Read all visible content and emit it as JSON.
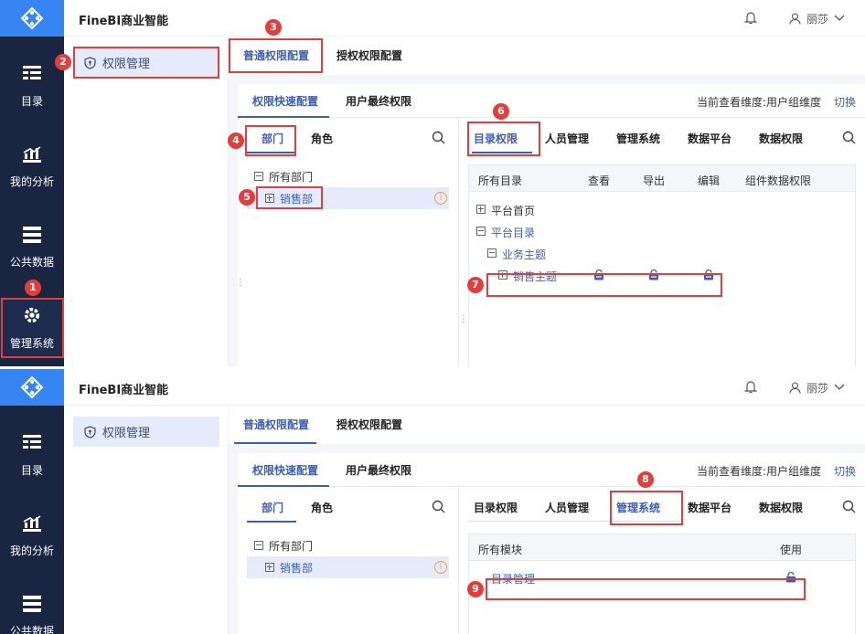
{
  "app": {
    "brand": "FineBI商业智能",
    "user_name": "丽莎"
  },
  "nav": {
    "items": [
      {
        "label": "目录",
        "icon": "catalog-icon"
      },
      {
        "label": "我的分析",
        "icon": "analysis-icon"
      },
      {
        "label": "公共数据",
        "icon": "public-data-icon"
      },
      {
        "label": "管理系统",
        "icon": "admin-gear-icon"
      }
    ]
  },
  "sidebar": {
    "item_label": "权限管理"
  },
  "tabs_top": [
    "普通权限配置",
    "授权权限配置"
  ],
  "tabs_inner": [
    "权限快速配置",
    "用户最终权限"
  ],
  "view_dimension": "当前查看维度:用户组维度",
  "switch_label": "切换",
  "left_pane": {
    "tabs": [
      "部门",
      "角色"
    ],
    "root": "所有部门",
    "child": "销售部"
  },
  "right_pane": {
    "tabs": [
      "目录权限",
      "人员管理",
      "管理系统",
      "数据平台",
      "数据权限"
    ]
  },
  "catalog_table": {
    "headers": [
      "所有目录",
      "查看",
      "导出",
      "编辑",
      "组件数据权限"
    ],
    "rows": [
      "平台首页",
      "平台目录",
      "业务主题",
      "销售主题"
    ]
  },
  "module_table": {
    "headers": [
      "所有模块",
      "使用"
    ],
    "rows": [
      "目录管理"
    ]
  },
  "badges": [
    "1",
    "2",
    "3",
    "4",
    "5",
    "6",
    "7",
    "8",
    "9"
  ],
  "colors": {
    "accent": "#3d5eb5",
    "nav_bg": "#1a2541",
    "logo_bg": "#3685f2",
    "annotation_red": "#e43d3d"
  }
}
